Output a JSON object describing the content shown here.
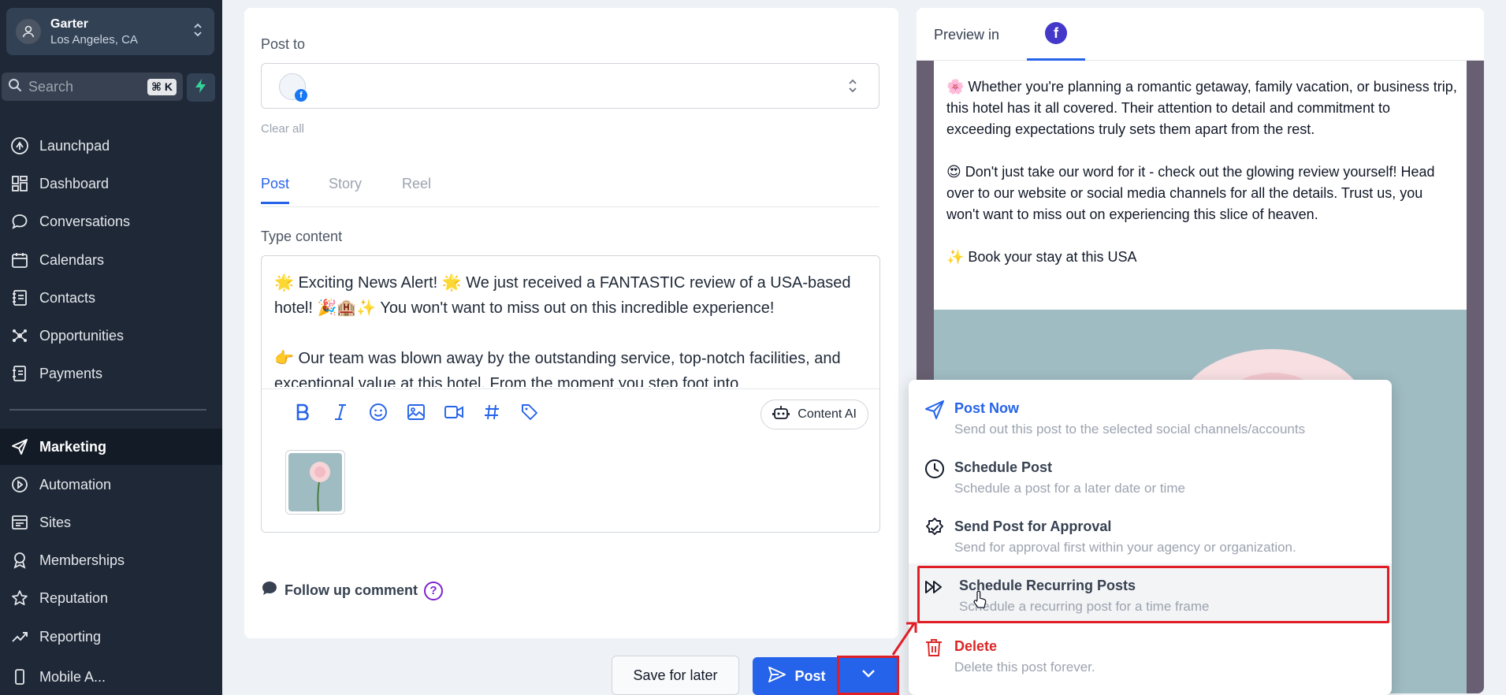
{
  "sidebar": {
    "location_name": "Garter",
    "location_city": "Los Angeles, CA",
    "search_placeholder": "Search",
    "search_shortcut": "⌘ K",
    "items": [
      {
        "label": "Launchpad",
        "icon": "launchpad-icon"
      },
      {
        "label": "Dashboard",
        "icon": "dashboard-icon"
      },
      {
        "label": "Conversations",
        "icon": "chat-icon"
      },
      {
        "label": "Calendars",
        "icon": "calendar-icon"
      },
      {
        "label": "Contacts",
        "icon": "contacts-icon"
      },
      {
        "label": "Opportunities",
        "icon": "opportunities-icon"
      },
      {
        "label": "Payments",
        "icon": "payments-icon"
      },
      {
        "label": "Marketing",
        "icon": "send-icon",
        "active": true
      },
      {
        "label": "Automation",
        "icon": "automation-icon"
      },
      {
        "label": "Sites",
        "icon": "sites-icon"
      },
      {
        "label": "Memberships",
        "icon": "badge-icon"
      },
      {
        "label": "Reputation",
        "icon": "star-icon"
      },
      {
        "label": "Reporting",
        "icon": "chart-icon"
      },
      {
        "label": "Mobile A...",
        "icon": "mobile-icon"
      }
    ]
  },
  "composer": {
    "post_to_label": "Post to",
    "clear_all": "Clear all",
    "tabs": [
      "Post",
      "Story",
      "Reel"
    ],
    "type_content_label": "Type content",
    "content_lines": [
      "🌟 Exciting News Alert! 🌟 We just received a FANTASTIC review of a USA-based hotel! 🎉🏨✨ You won't want to miss out on this incredible experience!",
      "👉 Our team was blown away by the outstanding service, top-notch facilities, and exceptional value at this hotel. From the moment you step foot into"
    ],
    "content_ai_label": "Content AI",
    "follow_up_label": "Follow up comment",
    "help_glyph": "?"
  },
  "preview": {
    "title": "Preview in",
    "network_glyph": "f",
    "paragraphs": [
      "🌸 Whether you're planning a romantic getaway, family vacation, or business trip, this hotel has it all covered. Their attention to detail and commitment to exceeding expectations truly sets them apart from the rest.",
      "😍 Don't just take our word for it - check out the glowing review yourself! Head over to our website or social media channels for all the details. Trust us, you won't want to miss out on experiencing this slice of heaven.",
      "✨ Book your stay at this USA"
    ]
  },
  "actions": {
    "save_for_later": "Save for later",
    "post": "Post"
  },
  "dropdown": {
    "items": [
      {
        "title": "Post Now",
        "desc": "Send out this post to the selected social channels/accounts",
        "icon": "send-icon"
      },
      {
        "title": "Schedule Post",
        "desc": "Schedule a post for a later date or time",
        "icon": "clock-icon"
      },
      {
        "title": "Send Post for Approval",
        "desc": "Send for approval first within your agency or organization.",
        "icon": "approval-badge-icon"
      },
      {
        "title": "Schedule Recurring Posts",
        "desc": "Schedule a recurring post for a time frame",
        "icon": "fast-forward-icon"
      },
      {
        "title": "Delete",
        "desc": "Delete this post forever.",
        "icon": "trash-icon"
      }
    ]
  },
  "colors": {
    "sidebar_bg": "#1e2837",
    "accent": "#2563eb",
    "danger": "#dc2626",
    "annotation_red": "#e01e26"
  }
}
